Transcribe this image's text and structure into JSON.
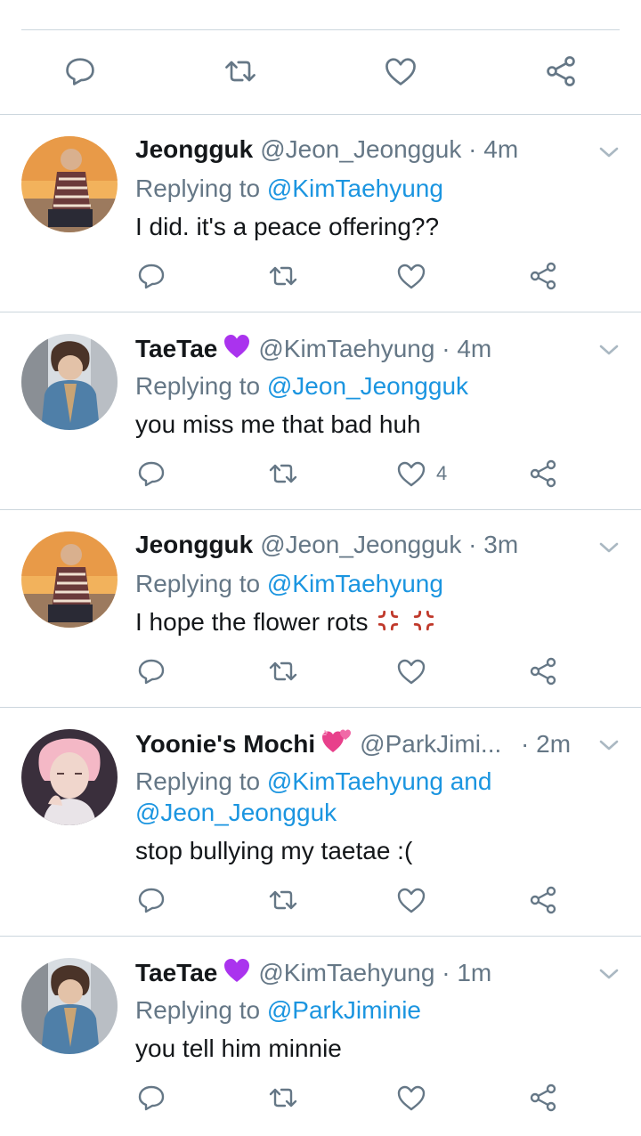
{
  "colors": {
    "link": "#1b95e0",
    "secondary": "#657786",
    "divider": "#ccd6dd",
    "primary_text": "#14171a"
  },
  "top_bar": {
    "icons": [
      "reply-icon",
      "retweet-icon",
      "like-icon",
      "share-icon"
    ]
  },
  "tweets": [
    {
      "name": "Jeongguk",
      "handle": "@Jeon_Jeongguk",
      "dot": "·",
      "time": "4m",
      "replying_prefix": "Replying to",
      "replying_to": "@KimTaehyung",
      "text": "I did. it's a peace offering??",
      "like_count": ""
    },
    {
      "name": "TaeTae",
      "name_emoji": "purple-heart",
      "handle": "@KimTaehyung",
      "dot": "·",
      "time": "4m",
      "replying_prefix": "Replying to",
      "replying_to": "@Jeon_Jeongguk",
      "text": "you miss me that bad huh",
      "like_count": "4"
    },
    {
      "name": "Jeongguk",
      "handle": "@Jeon_Jeongguk",
      "dot": "·",
      "time": "3m",
      "replying_prefix": "Replying to",
      "replying_to": "@KimTaehyung",
      "text": "I hope the flower rots",
      "text_emoji": "anger-symbol x2",
      "like_count": ""
    },
    {
      "name": "Yoonie's Mochi",
      "name_emoji": "two-hearts",
      "handle": "@ParkJimi...",
      "dot": "·",
      "time": "2m",
      "replying_prefix": "Replying to",
      "replying_to": "@KimTaehyung",
      "replying_and": "and",
      "replying_to_2": "@Jeon_Jeongguk",
      "text": "stop bullying my taetae :(",
      "like_count": ""
    },
    {
      "name": "TaeTae",
      "name_emoji": "purple-heart",
      "handle": "@KimTaehyung",
      "dot": "·",
      "time": "1m",
      "replying_prefix": "Replying to",
      "replying_to": "@ParkJiminie",
      "text": "you tell him minnie",
      "like_count": ""
    }
  ]
}
